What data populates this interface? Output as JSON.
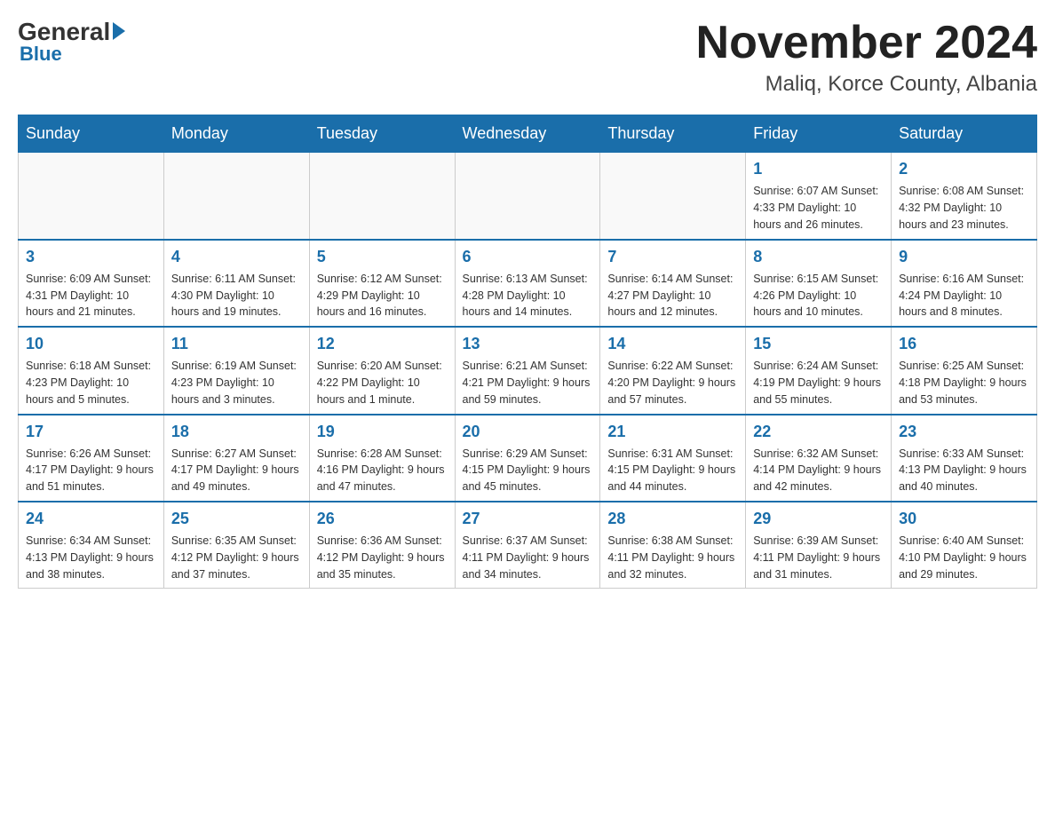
{
  "logo": {
    "general": "General",
    "blue": "Blue"
  },
  "header": {
    "title": "November 2024",
    "subtitle": "Maliq, Korce County, Albania"
  },
  "days_of_week": [
    "Sunday",
    "Monday",
    "Tuesday",
    "Wednesday",
    "Thursday",
    "Friday",
    "Saturday"
  ],
  "weeks": [
    [
      {
        "day": "",
        "info": ""
      },
      {
        "day": "",
        "info": ""
      },
      {
        "day": "",
        "info": ""
      },
      {
        "day": "",
        "info": ""
      },
      {
        "day": "",
        "info": ""
      },
      {
        "day": "1",
        "info": "Sunrise: 6:07 AM\nSunset: 4:33 PM\nDaylight: 10 hours and 26 minutes."
      },
      {
        "day": "2",
        "info": "Sunrise: 6:08 AM\nSunset: 4:32 PM\nDaylight: 10 hours and 23 minutes."
      }
    ],
    [
      {
        "day": "3",
        "info": "Sunrise: 6:09 AM\nSunset: 4:31 PM\nDaylight: 10 hours and 21 minutes."
      },
      {
        "day": "4",
        "info": "Sunrise: 6:11 AM\nSunset: 4:30 PM\nDaylight: 10 hours and 19 minutes."
      },
      {
        "day": "5",
        "info": "Sunrise: 6:12 AM\nSunset: 4:29 PM\nDaylight: 10 hours and 16 minutes."
      },
      {
        "day": "6",
        "info": "Sunrise: 6:13 AM\nSunset: 4:28 PM\nDaylight: 10 hours and 14 minutes."
      },
      {
        "day": "7",
        "info": "Sunrise: 6:14 AM\nSunset: 4:27 PM\nDaylight: 10 hours and 12 minutes."
      },
      {
        "day": "8",
        "info": "Sunrise: 6:15 AM\nSunset: 4:26 PM\nDaylight: 10 hours and 10 minutes."
      },
      {
        "day": "9",
        "info": "Sunrise: 6:16 AM\nSunset: 4:24 PM\nDaylight: 10 hours and 8 minutes."
      }
    ],
    [
      {
        "day": "10",
        "info": "Sunrise: 6:18 AM\nSunset: 4:23 PM\nDaylight: 10 hours and 5 minutes."
      },
      {
        "day": "11",
        "info": "Sunrise: 6:19 AM\nSunset: 4:23 PM\nDaylight: 10 hours and 3 minutes."
      },
      {
        "day": "12",
        "info": "Sunrise: 6:20 AM\nSunset: 4:22 PM\nDaylight: 10 hours and 1 minute."
      },
      {
        "day": "13",
        "info": "Sunrise: 6:21 AM\nSunset: 4:21 PM\nDaylight: 9 hours and 59 minutes."
      },
      {
        "day": "14",
        "info": "Sunrise: 6:22 AM\nSunset: 4:20 PM\nDaylight: 9 hours and 57 minutes."
      },
      {
        "day": "15",
        "info": "Sunrise: 6:24 AM\nSunset: 4:19 PM\nDaylight: 9 hours and 55 minutes."
      },
      {
        "day": "16",
        "info": "Sunrise: 6:25 AM\nSunset: 4:18 PM\nDaylight: 9 hours and 53 minutes."
      }
    ],
    [
      {
        "day": "17",
        "info": "Sunrise: 6:26 AM\nSunset: 4:17 PM\nDaylight: 9 hours and 51 minutes."
      },
      {
        "day": "18",
        "info": "Sunrise: 6:27 AM\nSunset: 4:17 PM\nDaylight: 9 hours and 49 minutes."
      },
      {
        "day": "19",
        "info": "Sunrise: 6:28 AM\nSunset: 4:16 PM\nDaylight: 9 hours and 47 minutes."
      },
      {
        "day": "20",
        "info": "Sunrise: 6:29 AM\nSunset: 4:15 PM\nDaylight: 9 hours and 45 minutes."
      },
      {
        "day": "21",
        "info": "Sunrise: 6:31 AM\nSunset: 4:15 PM\nDaylight: 9 hours and 44 minutes."
      },
      {
        "day": "22",
        "info": "Sunrise: 6:32 AM\nSunset: 4:14 PM\nDaylight: 9 hours and 42 minutes."
      },
      {
        "day": "23",
        "info": "Sunrise: 6:33 AM\nSunset: 4:13 PM\nDaylight: 9 hours and 40 minutes."
      }
    ],
    [
      {
        "day": "24",
        "info": "Sunrise: 6:34 AM\nSunset: 4:13 PM\nDaylight: 9 hours and 38 minutes."
      },
      {
        "day": "25",
        "info": "Sunrise: 6:35 AM\nSunset: 4:12 PM\nDaylight: 9 hours and 37 minutes."
      },
      {
        "day": "26",
        "info": "Sunrise: 6:36 AM\nSunset: 4:12 PM\nDaylight: 9 hours and 35 minutes."
      },
      {
        "day": "27",
        "info": "Sunrise: 6:37 AM\nSunset: 4:11 PM\nDaylight: 9 hours and 34 minutes."
      },
      {
        "day": "28",
        "info": "Sunrise: 6:38 AM\nSunset: 4:11 PM\nDaylight: 9 hours and 32 minutes."
      },
      {
        "day": "29",
        "info": "Sunrise: 6:39 AM\nSunset: 4:11 PM\nDaylight: 9 hours and 31 minutes."
      },
      {
        "day": "30",
        "info": "Sunrise: 6:40 AM\nSunset: 4:10 PM\nDaylight: 9 hours and 29 minutes."
      }
    ]
  ]
}
